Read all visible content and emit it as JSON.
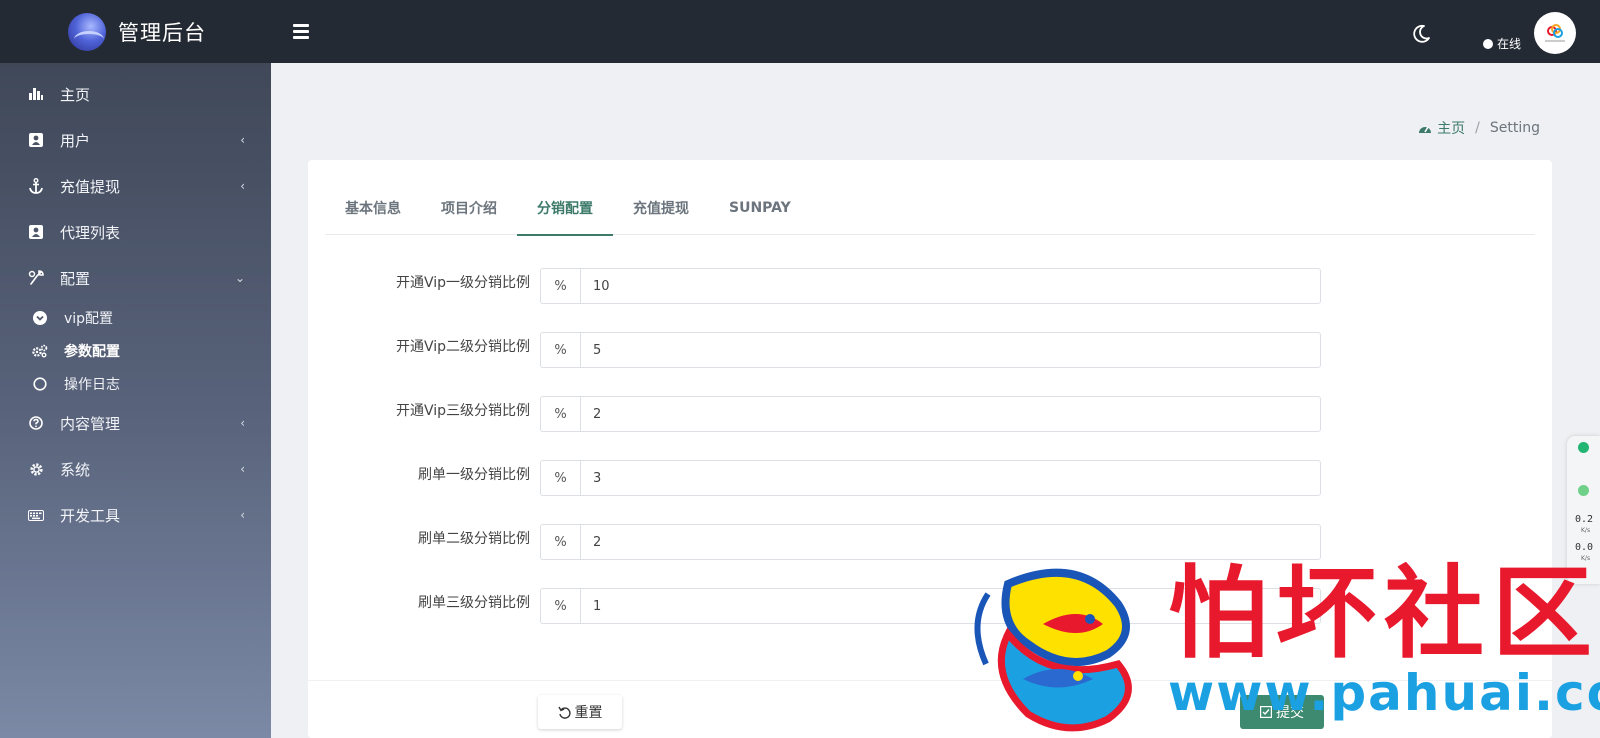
{
  "brand": {
    "title": "管理后台"
  },
  "sidebar": {
    "items": [
      {
        "label": "主页",
        "icon": "bar-chart-icon",
        "has_arrow": false
      },
      {
        "label": "用户",
        "icon": "user-card-icon",
        "has_arrow": true
      },
      {
        "label": "充值提现",
        "icon": "anchor-icon",
        "has_arrow": true
      },
      {
        "label": "代理列表",
        "icon": "user-card-icon",
        "has_arrow": false
      },
      {
        "label": "配置",
        "icon": "wrench-icon",
        "has_arrow": true,
        "expanded": true
      },
      {
        "label": "内容管理",
        "icon": "question-icon",
        "has_arrow": true
      },
      {
        "label": "系统",
        "icon": "gear-icon",
        "has_arrow": true
      },
      {
        "label": "开发工具",
        "icon": "keyboard-icon",
        "has_arrow": true
      }
    ],
    "subitems": [
      {
        "label": "vip配置",
        "icon": "chevron-circle-icon"
      },
      {
        "label": "参数配置",
        "icon": "cogs-icon",
        "active": true
      },
      {
        "label": "操作日志",
        "icon": "circle-icon"
      }
    ]
  },
  "topbar": {
    "status": "在线"
  },
  "breadcrumb": {
    "home": "主页",
    "sep": "/",
    "current": "Setting"
  },
  "tabs": [
    {
      "label": "基本信息"
    },
    {
      "label": "项目介绍"
    },
    {
      "label": "分销配置",
      "active": true
    },
    {
      "label": "充值提现"
    },
    {
      "label": "SUNPAY"
    }
  ],
  "form": {
    "rows": [
      {
        "label": "开通Vip一级分销比例",
        "addon": "%",
        "value": "10"
      },
      {
        "label": "开通Vip二级分销比例",
        "addon": "%",
        "value": "5"
      },
      {
        "label": "开通Vip三级分销比例",
        "addon": "%",
        "value": "2"
      },
      {
        "label": "刷单一级分销比例",
        "addon": "%",
        "value": "3"
      },
      {
        "label": "刷单二级分销比例",
        "addon": "%",
        "value": "2"
      },
      {
        "label": "刷单三级分销比例",
        "addon": "%",
        "value": "1"
      }
    ],
    "reset_label": "重置",
    "submit_label": "提交"
  },
  "widget": {
    "up": "0.2",
    "down": "0.0",
    "unit": "K/s"
  },
  "watermark": {
    "brand": "怕坏社区",
    "url": "www.pahuai.com"
  },
  "colors": {
    "accent": "#3d7a6a",
    "topbar": "#242a33",
    "watermark_red": "#e8192c",
    "watermark_blue": "#1ba1e2"
  }
}
